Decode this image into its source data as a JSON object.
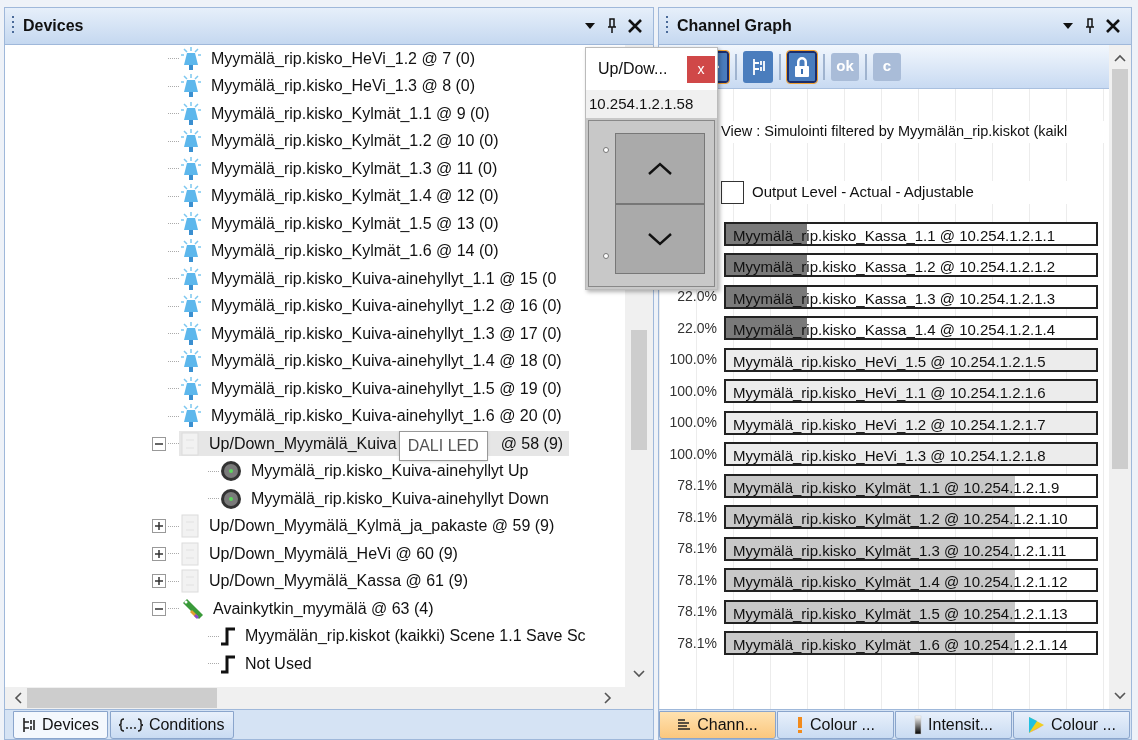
{
  "devices_panel": {
    "title": "Devices",
    "tooltip": "DALI LED",
    "tree": [
      {
        "kind": "light",
        "label": "Myymälä_rip.kisko_HeVi_1.2 @ 7 (0)",
        "selected": false
      },
      {
        "kind": "light",
        "label": "Myymälä_rip.kisko_HeVi_1.3 @ 8 (0)",
        "selected": false
      },
      {
        "kind": "light",
        "label": "Myymälä_rip.kisko_Kylmät_1.1 @ 9 (0)",
        "selected": false
      },
      {
        "kind": "light",
        "label": "Myymälä_rip.kisko_Kylmät_1.2 @ 10 (0)",
        "selected": false
      },
      {
        "kind": "light",
        "label": "Myymälä_rip.kisko_Kylmät_1.3 @ 11 (0)",
        "selected": false
      },
      {
        "kind": "light",
        "label": "Myymälä_rip.kisko_Kylmät_1.4 @ 12 (0)",
        "selected": false
      },
      {
        "kind": "light",
        "label": "Myymälä_rip.kisko_Kylmät_1.5 @ 13 (0)",
        "selected": false
      },
      {
        "kind": "light",
        "label": "Myymälä_rip.kisko_Kylmät_1.6 @ 14 (0)",
        "selected": false
      },
      {
        "kind": "light",
        "label": "Myymälä_rip.kisko_Kuiva-ainehyllyt_1.1 @ 15 (0",
        "selected": false
      },
      {
        "kind": "light",
        "label": "Myymälä_rip.kisko_Kuiva-ainehyllyt_1.2 @ 16 (0)",
        "selected": false
      },
      {
        "kind": "light",
        "label": "Myymälä_rip.kisko_Kuiva-ainehyllyt_1.3 @ 17 (0)",
        "selected": false
      },
      {
        "kind": "light",
        "label": "Myymälä_rip.kisko_Kuiva-ainehyllyt_1.4 @ 18 (0)",
        "selected": false
      },
      {
        "kind": "light",
        "label": "Myymälä_rip.kisko_Kuiva-ainehyllyt_1.5 @ 19 (0)",
        "selected": false
      },
      {
        "kind": "light",
        "label": "Myymälä_rip.kisko_Kuiva-ainehyllyt_1.6 @ 20 (0)",
        "selected": false
      },
      {
        "kind": "updown",
        "label": "Up/Down_Myymälä_Kuiva",
        "label_end": "@ 58 (9)",
        "selected": true,
        "expanded": true,
        "children": [
          {
            "kind": "button",
            "label": "Myymälä_rip.kisko_Kuiva-ainehyllyt Up",
            "selected": false
          },
          {
            "kind": "button",
            "label": "Myymälä_rip.kisko_Kuiva-ainehyllyt Down",
            "selected": false
          }
        ]
      },
      {
        "kind": "updown",
        "label": "Up/Down_Myymälä_Kylmä_ja_pakaste @ 59 (9)",
        "selected": false,
        "expanded": false
      },
      {
        "kind": "updown",
        "label": "Up/Down_Myymälä_HeVi @ 60 (9)",
        "selected": false,
        "expanded": false
      },
      {
        "kind": "updown",
        "label": "Up/Down_Myymälä_Kassa @ 61 (9)",
        "selected": false,
        "expanded": false
      },
      {
        "kind": "switch",
        "label": "Avainkytkin_myymälä @ 63 (4)",
        "selected": false,
        "expanded": true,
        "children": [
          {
            "kind": "scene",
            "label": "Myymälän_rip.kiskot (kaikki) Scene 1.1 Save Sc",
            "selected": false
          },
          {
            "kind": "scene",
            "label": "Not Used",
            "selected": false
          }
        ]
      }
    ]
  },
  "popup": {
    "title": "Up/Dow...",
    "close": "x",
    "address": "10.254.1.2.1.58"
  },
  "channel_panel": {
    "title": "Channel Graph",
    "toolbar": [
      {
        "kind": "people",
        "selected": true
      },
      {
        "kind": "tree",
        "selected": false
      },
      {
        "kind": "lock",
        "selected": true
      },
      {
        "kind": "text",
        "label": "ok",
        "disabled": true
      },
      {
        "kind": "text",
        "label": "c",
        "disabled": true
      }
    ],
    "view_text": "View : Simulointi filtered by Myymälän_rip.kiskot (kaikl",
    "checkbox": {
      "label": "Output Level - Actual - Adjustable",
      "checked": false
    },
    "channels": [
      {
        "label": "Myymälä_rip.kisko_Kassa_1.1 @ 10.254.1.2.1.1",
        "level": 0.22,
        "color": "#7a7a7a"
      },
      {
        "label": "Myymälä_rip.kisko_Kassa_1.2 @ 10.254.1.2.1.2",
        "level": 0.22,
        "color": "#7a7a7a"
      },
      {
        "percent": "22.0%",
        "label": "Myymälä_rip.kisko_Kassa_1.3 @ 10.254.1.2.1.3",
        "level": 0.22,
        "color": "#7a7a7a"
      },
      {
        "percent": "22.0%",
        "label": "Myymälä_rip.kisko_Kassa_1.4 @ 10.254.1.2.1.4",
        "level": 0.22,
        "color": "#7a7a7a"
      },
      {
        "percent": "100.0%",
        "label": "Myymälä_rip.kisko_HeVi_1.5 @ 10.254.1.2.1.5",
        "level": 1,
        "color": "#ececec"
      },
      {
        "percent": "100.0%",
        "label": "Myymälä_rip.kisko_HeVi_1.1 @ 10.254.1.2.1.6",
        "level": 1,
        "color": "#ececec"
      },
      {
        "percent": "100.0%",
        "label": "Myymälä_rip.kisko_HeVi_1.2 @ 10.254.1.2.1.7",
        "level": 1,
        "color": "#ececec"
      },
      {
        "percent": "100.0%",
        "label": "Myymälä_rip.kisko_HeVi_1.3 @ 10.254.1.2.1.8",
        "level": 1,
        "color": "#ececec"
      },
      {
        "percent": "78.1%",
        "label": "Myymälä_rip.kisko_Kylmät_1.1 @ 10.254.1.2.1.9",
        "level": 0.781,
        "color": "#c8c8c8"
      },
      {
        "percent": "78.1%",
        "label": "Myymälä_rip.kisko_Kylmät_1.2 @ 10.254.1.2.1.10",
        "level": 0.781,
        "color": "#c8c8c8"
      },
      {
        "percent": "78.1%",
        "label": "Myymälä_rip.kisko_Kylmät_1.3 @ 10.254.1.2.1.11",
        "level": 0.781,
        "color": "#c8c8c8"
      },
      {
        "percent": "78.1%",
        "label": "Myymälä_rip.kisko_Kylmät_1.4 @ 10.254.1.2.1.12",
        "level": 0.781,
        "color": "#c8c8c8"
      },
      {
        "percent": "78.1%",
        "label": "Myymälä_rip.kisko_Kylmät_1.5 @ 10.254.1.2.1.13",
        "level": 0.781,
        "color": "#c8c8c8"
      },
      {
        "percent": "78.1%",
        "label": "Myymälä_rip.kisko_Kylmät_1.6 @ 10.254.1.2.1.14",
        "level": 0.781,
        "color": "#c8c8c8"
      }
    ]
  },
  "left_tabs": [
    {
      "kind": "devices",
      "label": "Devices",
      "selected": true
    },
    {
      "kind": "conditions",
      "label": "Conditions",
      "selected": false
    }
  ],
  "right_tabs": [
    {
      "kind": "list",
      "label": "Chann...",
      "selected": true
    },
    {
      "kind": "colour",
      "label": "Colour ...",
      "selected": false
    },
    {
      "kind": "intensity",
      "label": "Intensit...",
      "selected": false
    },
    {
      "kind": "rainbow",
      "label": "Colour ...",
      "selected": false
    }
  ]
}
